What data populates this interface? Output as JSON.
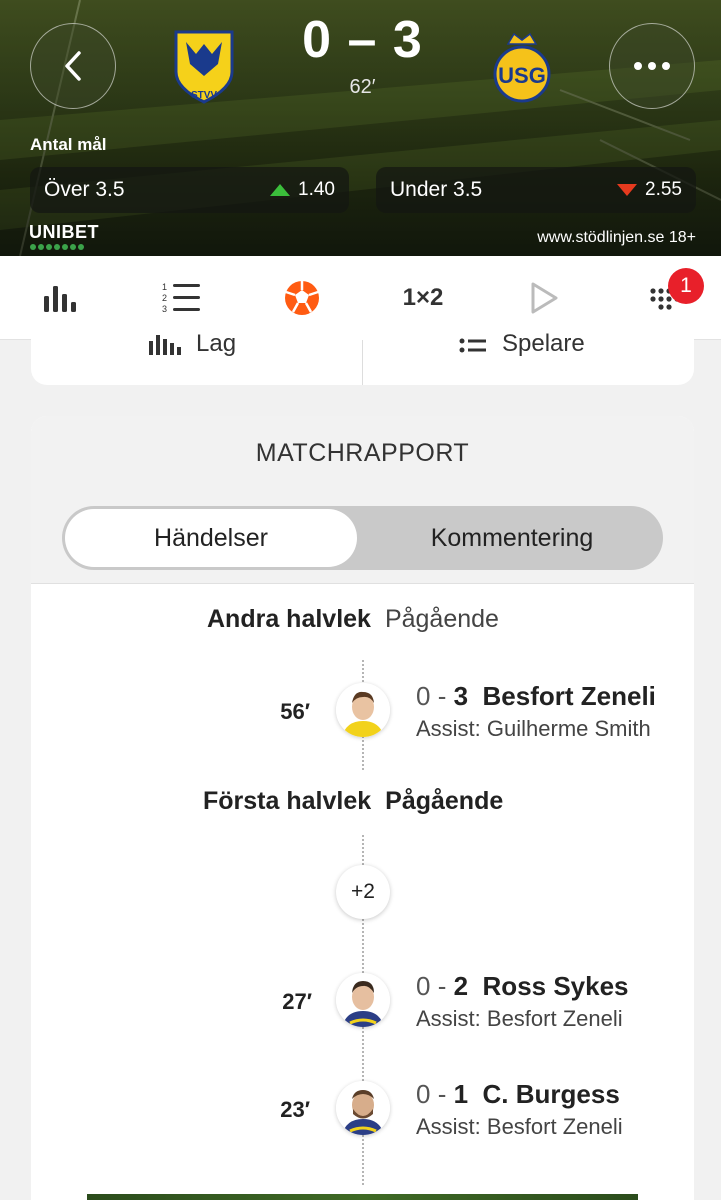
{
  "match": {
    "score": "0 – 3",
    "minute": "62′",
    "home_team": "STVV",
    "away_team": "USG"
  },
  "market": {
    "title": "Antal mål",
    "over_label": "Över 3.5",
    "over_odds": "1.40",
    "under_label": "Under 3.5",
    "under_odds": "2.55"
  },
  "brand": {
    "name": "UNIBET",
    "rg_text": "www.stödlinjen.se 18+"
  },
  "tabs": [
    {
      "icon": "stats-bars-icon"
    },
    {
      "icon": "standings-list-icon"
    },
    {
      "icon": "football-icon",
      "active": true
    },
    {
      "icon": "odds-1x2-icon",
      "label": "1×2"
    },
    {
      "icon": "play-icon"
    },
    {
      "icon": "more-grid-icon",
      "badge": "1"
    }
  ],
  "filters": {
    "lag": "Lag",
    "spelare": "Spelare"
  },
  "report": {
    "title": "MATCHRAPPORT",
    "segments": {
      "active": "Händelser",
      "inactive": "Kommentering"
    },
    "periods": [
      {
        "name": "Andra halvlek",
        "status": "Pågående"
      },
      {
        "name": "Första halvlek",
        "status": "Pågående"
      }
    ],
    "events": [
      {
        "minute": "56′",
        "score_home": "0",
        "score_sep": "-",
        "score_away": "3",
        "player": "Besfort Zeneli",
        "assist": "Assist: Guilherme Smith"
      },
      {
        "minute": "27′",
        "score_home": "0",
        "score_sep": "-",
        "score_away": "2",
        "player": "Ross Sykes",
        "assist": "Assist: Besfort Zeneli"
      },
      {
        "minute": "23′",
        "score_home": "0",
        "score_sep": "-",
        "score_away": "1",
        "player": "C. Burgess",
        "assist": "Assist: Besfort Zeneli"
      }
    ],
    "more_events": "+2"
  },
  "colors": {
    "accent": "#ff5b12",
    "badge": "#e8202a",
    "up": "#3bbf3b",
    "down": "#e53a1e"
  }
}
